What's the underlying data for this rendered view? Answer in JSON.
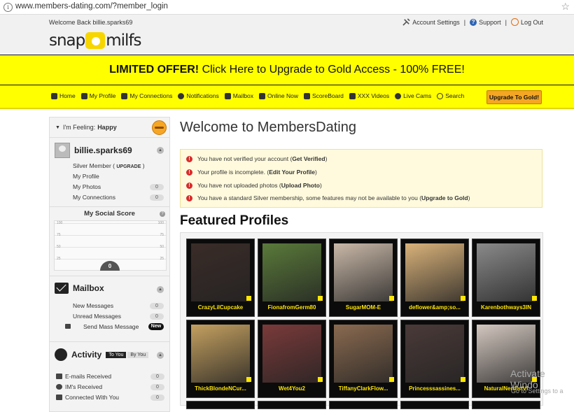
{
  "browser": {
    "url": "www.members-dating.com/?member_login"
  },
  "header": {
    "welcome": "Welcome Back billie.sparks69",
    "account_settings": "Account Settings",
    "support": "Support",
    "logout": "Log Out",
    "logo_left": "snap",
    "logo_right": "milfs"
  },
  "offer": {
    "bold": "LIMITED OFFER!",
    "text": " Click Here to Upgrade to Gold Access - 100% FREE!"
  },
  "nav": {
    "items": [
      "Home",
      "My Profile",
      "My Connections",
      "Notifications",
      "Mailbox",
      "Online Now",
      "ScoreBoard",
      "XXX Videos",
      "Live Cams",
      "Search"
    ],
    "upgrade": "Upgrade To Gold!"
  },
  "sidebar": {
    "feeling_label": "I'm Feeling:",
    "feeling_value": "Happy",
    "username": "billie.sparks69",
    "membership": "Silver Member (",
    "upgrade": "UPGRADE",
    "membership_close": ")",
    "my_profile": "My Profile",
    "my_photos": "My Photos",
    "my_photos_count": "0",
    "my_connections": "My Connections",
    "my_connections_count": "0",
    "social_score_title": "My Social Score",
    "social_score_value": "0",
    "score_ticks_left": [
      "100",
      "75",
      "50",
      "25"
    ],
    "score_ticks_right": [
      "100",
      "75",
      "50",
      "25"
    ],
    "mailbox_title": "Mailbox",
    "new_messages": "New Messages",
    "new_messages_count": "0",
    "unread_messages": "Unread Messages",
    "unread_messages_count": "0",
    "send_mass": "Send Mass Message",
    "send_mass_badge": "New",
    "activity_title": "Activity",
    "to_you": "To You",
    "by_you": "By You",
    "emails_received": "E-mails Received",
    "emails_received_count": "0",
    "ims_received": "IM's Received",
    "ims_received_count": "0",
    "connected_with_you": "Connected With You",
    "connected_with_you_count": "0"
  },
  "main": {
    "title": "Welcome to MembersDating",
    "alerts": [
      {
        "text": "You have not verified your account ( ",
        "link": "Get Verified",
        "close": " )"
      },
      {
        "text": "Your profile is incomplete. ( ",
        "link": "Edit Your Profile",
        "close": " )"
      },
      {
        "text": "You have not uploaded photos ( ",
        "link": "Upload Photo",
        "close": " )"
      },
      {
        "text": "You have a standard Silver membership, some features may not be available to you ( ",
        "link": "Upgrade to Gold",
        "close": " )"
      }
    ],
    "featured_title": "Featured Profiles",
    "profiles": [
      {
        "name": "CrazyLilCupcake",
        "color": "#3a2c28"
      },
      {
        "name": "FionafromGerm80",
        "color": "#5a7a3a"
      },
      {
        "name": "SugarMOM-E",
        "color": "#c9b8a8"
      },
      {
        "name": "deflower&amp;so...",
        "color": "#d9b27a"
      },
      {
        "name": "Karenbothways3IN",
        "color": "#8a8a8a"
      },
      {
        "name": "ThickBlondeNCur...",
        "color": "#c4a060"
      },
      {
        "name": "Wet4You2",
        "color": "#7a3a3a"
      },
      {
        "name": "TiffanyClarkFlow...",
        "color": "#8a6a50"
      },
      {
        "name": "Princesssassines...",
        "color": "#4a3a38"
      },
      {
        "name": "NaturalNerdistVI",
        "color": "#d4c8c0"
      }
    ]
  },
  "watermark": {
    "line1": "Activate Windo",
    "line2": "Go to Settings to a"
  }
}
